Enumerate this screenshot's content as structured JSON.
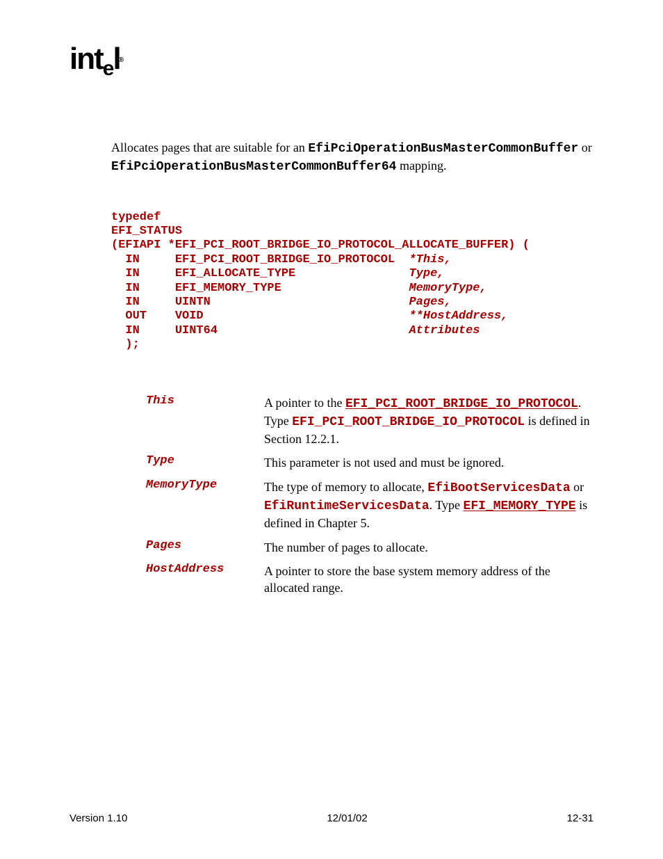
{
  "logo": {
    "text": "int",
    "sub": "e",
    "sub2": "l",
    "reg": "®"
  },
  "summary": {
    "pre": "Allocates pages that are suitable for an ",
    "code1": "EfiPciOperationBusMasterCommonBuffer",
    "mid": " or ",
    "code2": "EfiPciOperationBusMasterCommonBuffer64",
    "post": " mapping."
  },
  "proto": {
    "l1": "typedef",
    "l2": "EFI_STATUS",
    "l3": "(EFIAPI *EFI_PCI_ROOT_BRIDGE_IO_PROTOCOL_ALLOCATE_BUFFER) (",
    "r1a": "  IN     EFI_PCI_ROOT_BRIDGE_IO_PROTOCOL  ",
    "r1b": "*This,",
    "r2a": "  IN     EFI_ALLOCATE_TYPE                ",
    "r2b": "Type,",
    "r3a": "  IN     EFI_MEMORY_TYPE                  ",
    "r3b": "MemoryType,",
    "r4a": "  IN     UINTN                            ",
    "r4b": "Pages,",
    "r5a": "  OUT    VOID                             ",
    "r5b": "**HostAddress,",
    "r6a": "  IN     UINT64                           ",
    "r6b": "Attributes",
    "r7": "  );"
  },
  "params": {
    "this": {
      "name": "This",
      "t1": "A pointer to the ",
      "link1": "EFI_PCI_ROOT_BRIDGE_IO_PROTOCOL",
      "t2": ". Type ",
      "code1": "EFI_PCI_ROOT_BRIDGE_IO_PROTOCOL",
      "t3": " is defined in Section 12.2.1."
    },
    "type": {
      "name": "Type",
      "t1": "This parameter is not used and must be ignored."
    },
    "memtype": {
      "name": "MemoryType",
      "t1": "The type of memory to allocate, ",
      "code1": "EfiBootServicesData",
      "t2": " or ",
      "code2": "EfiRuntimeServicesData",
      "t3": ".  Type ",
      "link1": "EFI_MEMORY_TYPE",
      "t4": " is defined in Chapter 5."
    },
    "pages": {
      "name": "Pages",
      "t1": "The number of pages to allocate."
    },
    "hostaddr": {
      "name": "HostAddress",
      "t1": "A pointer to store the base system memory address of the allocated range."
    }
  },
  "footer": {
    "left": "Version 1.10",
    "center": "12/01/02",
    "right": "12-31"
  }
}
